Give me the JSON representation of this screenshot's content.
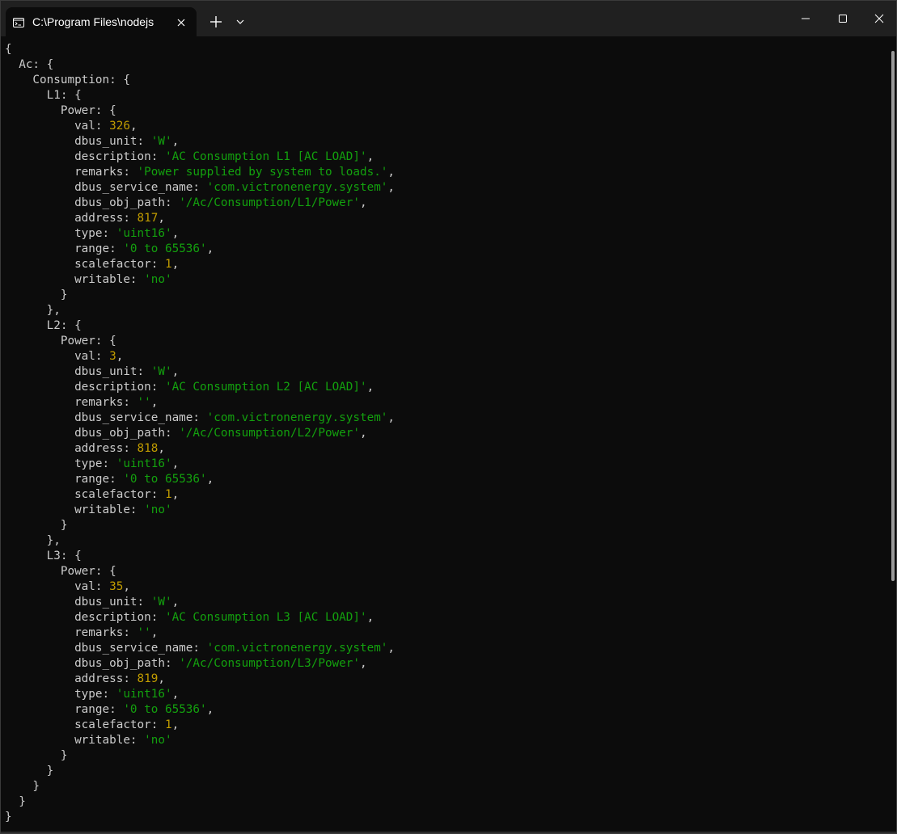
{
  "window": {
    "tab_title": "C:\\Program Files\\nodejs"
  },
  "icons": {
    "tab": "terminal-icon",
    "close_tab": "close-icon",
    "new_tab": "plus-icon",
    "dropdown": "chevron-down-icon",
    "minimize": "minimize-icon",
    "maximize": "maximize-icon",
    "close_window": "close-icon"
  },
  "colors": {
    "background": "#0c0c0c",
    "titlebar": "#202020",
    "text": "#cccccc",
    "number": "#c19c00",
    "string": "#13a10e"
  },
  "output": [
    [
      {
        "t": "{"
      }
    ],
    [
      {
        "t": "  Ac: {"
      }
    ],
    [
      {
        "t": "    Consumption: {"
      }
    ],
    [
      {
        "t": "      L1: {"
      }
    ],
    [
      {
        "t": "        Power: {"
      }
    ],
    [
      {
        "t": "          val: "
      },
      {
        "t": "326",
        "c": "num"
      },
      {
        "t": ","
      }
    ],
    [
      {
        "t": "          dbus_unit: "
      },
      {
        "t": "'W'",
        "c": "str"
      },
      {
        "t": ","
      }
    ],
    [
      {
        "t": "          description: "
      },
      {
        "t": "'AC Consumption L1 [AC LOAD]'",
        "c": "str"
      },
      {
        "t": ","
      }
    ],
    [
      {
        "t": "          remarks: "
      },
      {
        "t": "'Power supplied by system to loads.'",
        "c": "str"
      },
      {
        "t": ","
      }
    ],
    [
      {
        "t": "          dbus_service_name: "
      },
      {
        "t": "'com.victronenergy.system'",
        "c": "str"
      },
      {
        "t": ","
      }
    ],
    [
      {
        "t": "          dbus_obj_path: "
      },
      {
        "t": "'/Ac/Consumption/L1/Power'",
        "c": "str"
      },
      {
        "t": ","
      }
    ],
    [
      {
        "t": "          address: "
      },
      {
        "t": "817",
        "c": "num"
      },
      {
        "t": ","
      }
    ],
    [
      {
        "t": "          type: "
      },
      {
        "t": "'uint16'",
        "c": "str"
      },
      {
        "t": ","
      }
    ],
    [
      {
        "t": "          range: "
      },
      {
        "t": "'0 to 65536'",
        "c": "str"
      },
      {
        "t": ","
      }
    ],
    [
      {
        "t": "          scalefactor: "
      },
      {
        "t": "1",
        "c": "num"
      },
      {
        "t": ","
      }
    ],
    [
      {
        "t": "          writable: "
      },
      {
        "t": "'no'",
        "c": "str"
      }
    ],
    [
      {
        "t": "        }"
      }
    ],
    [
      {
        "t": "      },"
      }
    ],
    [
      {
        "t": "      L2: {"
      }
    ],
    [
      {
        "t": "        Power: {"
      }
    ],
    [
      {
        "t": "          val: "
      },
      {
        "t": "3",
        "c": "num"
      },
      {
        "t": ","
      }
    ],
    [
      {
        "t": "          dbus_unit: "
      },
      {
        "t": "'W'",
        "c": "str"
      },
      {
        "t": ","
      }
    ],
    [
      {
        "t": "          description: "
      },
      {
        "t": "'AC Consumption L2 [AC LOAD]'",
        "c": "str"
      },
      {
        "t": ","
      }
    ],
    [
      {
        "t": "          remarks: "
      },
      {
        "t": "''",
        "c": "str"
      },
      {
        "t": ","
      }
    ],
    [
      {
        "t": "          dbus_service_name: "
      },
      {
        "t": "'com.victronenergy.system'",
        "c": "str"
      },
      {
        "t": ","
      }
    ],
    [
      {
        "t": "          dbus_obj_path: "
      },
      {
        "t": "'/Ac/Consumption/L2/Power'",
        "c": "str"
      },
      {
        "t": ","
      }
    ],
    [
      {
        "t": "          address: "
      },
      {
        "t": "818",
        "c": "num"
      },
      {
        "t": ","
      }
    ],
    [
      {
        "t": "          type: "
      },
      {
        "t": "'uint16'",
        "c": "str"
      },
      {
        "t": ","
      }
    ],
    [
      {
        "t": "          range: "
      },
      {
        "t": "'0 to 65536'",
        "c": "str"
      },
      {
        "t": ","
      }
    ],
    [
      {
        "t": "          scalefactor: "
      },
      {
        "t": "1",
        "c": "num"
      },
      {
        "t": ","
      }
    ],
    [
      {
        "t": "          writable: "
      },
      {
        "t": "'no'",
        "c": "str"
      }
    ],
    [
      {
        "t": "        }"
      }
    ],
    [
      {
        "t": "      },"
      }
    ],
    [
      {
        "t": "      L3: {"
      }
    ],
    [
      {
        "t": "        Power: {"
      }
    ],
    [
      {
        "t": "          val: "
      },
      {
        "t": "35",
        "c": "num"
      },
      {
        "t": ","
      }
    ],
    [
      {
        "t": "          dbus_unit: "
      },
      {
        "t": "'W'",
        "c": "str"
      },
      {
        "t": ","
      }
    ],
    [
      {
        "t": "          description: "
      },
      {
        "t": "'AC Consumption L3 [AC LOAD]'",
        "c": "str"
      },
      {
        "t": ","
      }
    ],
    [
      {
        "t": "          remarks: "
      },
      {
        "t": "''",
        "c": "str"
      },
      {
        "t": ","
      }
    ],
    [
      {
        "t": "          dbus_service_name: "
      },
      {
        "t": "'com.victronenergy.system'",
        "c": "str"
      },
      {
        "t": ","
      }
    ],
    [
      {
        "t": "          dbus_obj_path: "
      },
      {
        "t": "'/Ac/Consumption/L3/Power'",
        "c": "str"
      },
      {
        "t": ","
      }
    ],
    [
      {
        "t": "          address: "
      },
      {
        "t": "819",
        "c": "num"
      },
      {
        "t": ","
      }
    ],
    [
      {
        "t": "          type: "
      },
      {
        "t": "'uint16'",
        "c": "str"
      },
      {
        "t": ","
      }
    ],
    [
      {
        "t": "          range: "
      },
      {
        "t": "'0 to 65536'",
        "c": "str"
      },
      {
        "t": ","
      }
    ],
    [
      {
        "t": "          scalefactor: "
      },
      {
        "t": "1",
        "c": "num"
      },
      {
        "t": ","
      }
    ],
    [
      {
        "t": "          writable: "
      },
      {
        "t": "'no'",
        "c": "str"
      }
    ],
    [
      {
        "t": "        }"
      }
    ],
    [
      {
        "t": "      }"
      }
    ],
    [
      {
        "t": "    }"
      }
    ],
    [
      {
        "t": "  }"
      }
    ],
    [
      {
        "t": "}"
      }
    ]
  ]
}
